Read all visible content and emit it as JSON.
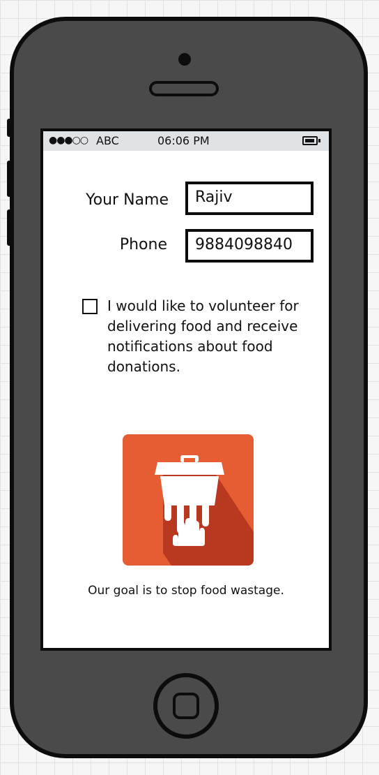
{
  "status_bar": {
    "signal_icon": "●●●○○",
    "carrier": "ABC",
    "time": "06:06 PM",
    "battery_icon": "battery-icon"
  },
  "form": {
    "name_label": "Your Name",
    "name_value": "Rajiv",
    "phone_label": "Phone",
    "phone_value": "9884098840"
  },
  "volunteer": {
    "checked": false,
    "text": "I would like to volunteer for delivering food and receive notifications about food donations."
  },
  "logo": {
    "icon": "trash-can-hand-icon",
    "colors": {
      "background": "#e65d33",
      "shadow": "#b8391f",
      "glyph": "#ffffff"
    }
  },
  "tagline": "Our goal is to stop food wastage."
}
